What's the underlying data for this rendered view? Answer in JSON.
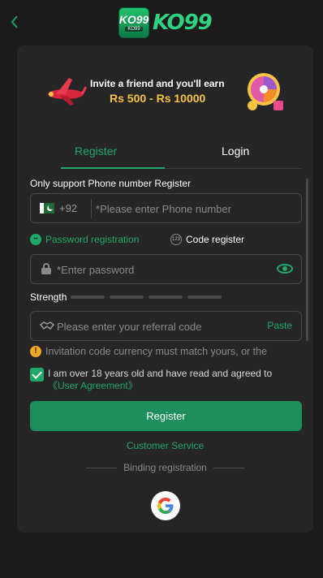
{
  "header": {
    "back_icon": "chevron-left-icon",
    "logo_badge_top": "KO99",
    "logo_badge_bottom": "KO99",
    "logo_word": "KO99"
  },
  "banner": {
    "line1": "Invite a friend and you'll earn",
    "line2": "Rs 500 - Rs 10000"
  },
  "tabs": [
    {
      "label": "Register",
      "active": true
    },
    {
      "label": "Login",
      "active": false
    }
  ],
  "form": {
    "only_support": "Only support Phone number Register",
    "phone": {
      "country_code": "+92",
      "required_mark": "*",
      "placeholder": "Please enter Phone number"
    },
    "methods": {
      "password": "Password registration",
      "code": "Code register",
      "code_icon_text": "123"
    },
    "password": {
      "required_mark": "*",
      "placeholder": "Enter password"
    },
    "strength_label": "Strength",
    "strength_level": 0,
    "referral": {
      "placeholder": "Please enter your referral code",
      "paste_label": "Paste"
    },
    "notice": "Invitation code currency must match yours, or the",
    "agreement": {
      "checked": true,
      "text": "I am over 18 years old and have read and agreed to ",
      "link": "《User Agreement》"
    },
    "register_button": "Register"
  },
  "footer": {
    "customer_service": "Customer Service",
    "binding_registration": "Binding registration"
  },
  "colors": {
    "accent": "#1fa869",
    "background": "#1b1b1b",
    "panel": "#262626",
    "button": "#1c8f5c",
    "banner_amount": "#f6c445"
  }
}
